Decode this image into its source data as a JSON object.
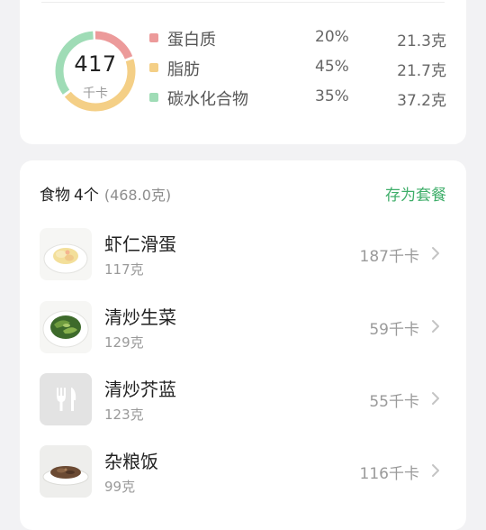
{
  "summary": {
    "total_kcal": "417",
    "kcal_unit": "千卡",
    "macros": [
      {
        "name": "蛋白质",
        "percent": "20%",
        "amount": "21.3克",
        "color": "#ec9a9a",
        "fraction": 0.2
      },
      {
        "name": "脂肪",
        "percent": "45%",
        "amount": "21.7克",
        "color": "#f4cf86",
        "fraction": 0.45
      },
      {
        "name": "碳水化合物",
        "percent": "35%",
        "amount": "37.2克",
        "color": "#9fdcb6",
        "fraction": 0.35
      }
    ]
  },
  "foods": {
    "title": "食物",
    "count": "4个",
    "total_weight": "(468.0克)",
    "save_label": "存为套餐",
    "items": [
      {
        "name": "虾仁滑蛋",
        "weight": "117克",
        "kcal": "187千卡",
        "icon": "shrimp-egg-dish-icon"
      },
      {
        "name": "清炒生菜",
        "weight": "129克",
        "kcal": "59千卡",
        "icon": "lettuce-dish-icon"
      },
      {
        "name": "清炒芥蓝",
        "weight": "123克",
        "kcal": "55千卡",
        "icon": "fork-knife-icon"
      },
      {
        "name": "杂粮饭",
        "weight": "99克",
        "kcal": "116千卡",
        "icon": "mixed-rice-dish-icon"
      }
    ]
  },
  "colors": {
    "accent": "#3fae6a",
    "protein": "#ec9a9a",
    "fat": "#f4cf86",
    "carbs": "#9fdcb6"
  }
}
